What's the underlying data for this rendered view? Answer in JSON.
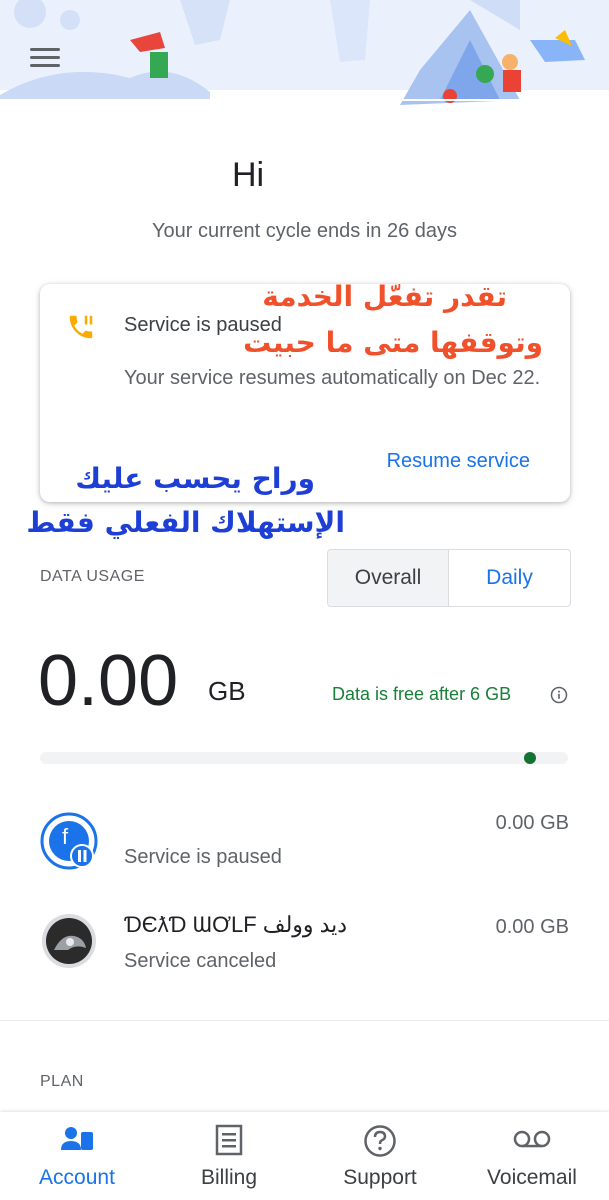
{
  "header": {
    "menu_icon": "hamburger-menu-icon"
  },
  "greeting": "Hi",
  "cycle_text": "Your current cycle ends in 26 days",
  "paused_card": {
    "icon": "phone-paused-icon",
    "title": "Service is paused",
    "body": "Your service resumes automatically on Dec 22.",
    "action": "Resume service"
  },
  "overlay_text": {
    "line1": "تقدر تفعّل الخدمة",
    "line2": "وتوقفها متى ما حبيت",
    "line3": "وراح يحسب عليك",
    "line4": "الإستهلاك الفعلي فقط"
  },
  "data_usage": {
    "title": "DATA USAGE",
    "tabs": [
      "Overall",
      "Daily"
    ],
    "selected_tab": "Overall",
    "value": "0.00",
    "unit": "GB",
    "free_note": "Data is free after 6 GB",
    "info_icon": "info-icon",
    "progress_fraction": 0
  },
  "lines": [
    {
      "title": "",
      "status": "Service is paused",
      "amount": "0.00 GB",
      "avatar_letter": "f",
      "avatar": "paused-avatar"
    },
    {
      "title": "ƊЄƛƊ ƜƠLF ديد وولف",
      "status": "Service canceled",
      "amount": "0.00 GB",
      "avatar": "wolf-photo-avatar"
    }
  ],
  "plan": {
    "title": "PLAN"
  },
  "nav": {
    "items": [
      {
        "label": "Account",
        "icon": "account-icon"
      },
      {
        "label": "Billing",
        "icon": "billing-icon"
      },
      {
        "label": "Support",
        "icon": "help-icon"
      },
      {
        "label": "Voicemail",
        "icon": "voicemail-icon"
      }
    ],
    "active": "Account"
  },
  "colors": {
    "accent": "#1a73e8",
    "free_green": "#188038",
    "paused_orange": "#f9ab00",
    "arabic_orange": "#f0502a",
    "arabic_blue": "#1d3fd6"
  }
}
